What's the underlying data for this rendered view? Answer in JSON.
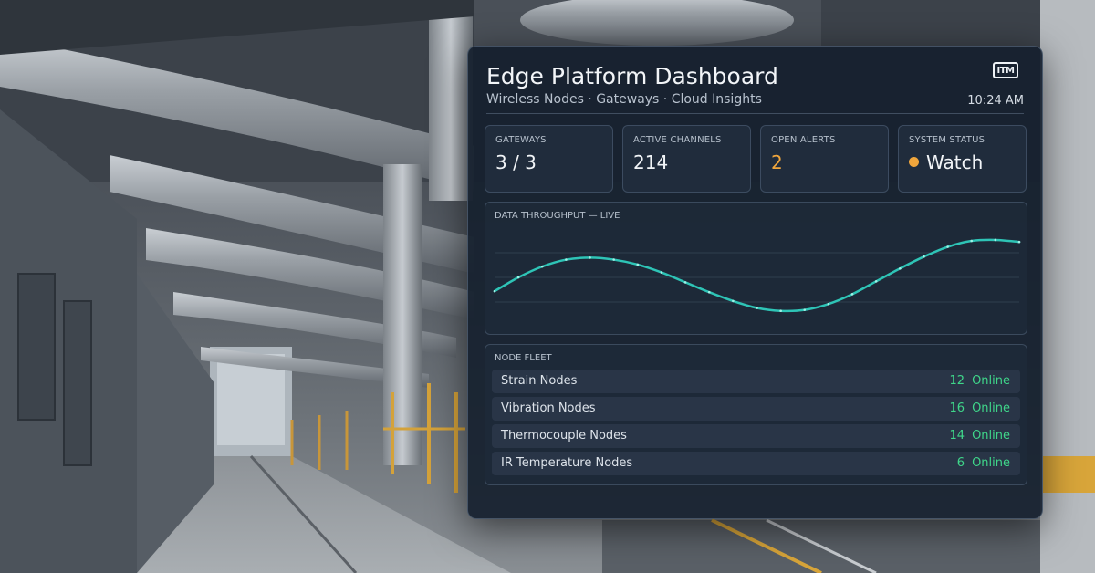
{
  "header": {
    "title": "Edge Platform Dashboard",
    "subtitle": "Wireless Nodes · Gateways · Cloud Insights",
    "logo": "ITM",
    "time": "10:24 AM"
  },
  "stats": [
    {
      "label": "GATEWAYS",
      "value": "3 / 3"
    },
    {
      "label": "ACTIVE CHANNELS",
      "value": "214"
    },
    {
      "label": "OPEN ALERTS",
      "value": "2"
    },
    {
      "label": "SYSTEM STATUS",
      "value": "Watch"
    }
  ],
  "colors": {
    "accent_line": "#2ec4b6",
    "alert": "#f0a63c",
    "online": "#3fd68a"
  },
  "throughput": {
    "label": "DATA THROUGHPUT — LIVE"
  },
  "chart_data": {
    "type": "line",
    "title": "",
    "xlabel": "",
    "ylabel": "",
    "x": [
      0,
      1,
      2,
      3,
      4,
      5,
      6,
      7,
      8,
      9,
      10,
      11,
      12,
      13,
      14,
      15,
      16,
      17,
      18,
      19,
      20,
      21,
      22
    ],
    "series": [
      {
        "values": [
          0.36,
          0.5,
          0.61,
          0.68,
          0.7,
          0.68,
          0.63,
          0.55,
          0.45,
          0.35,
          0.26,
          0.19,
          0.16,
          0.17,
          0.23,
          0.33,
          0.46,
          0.59,
          0.71,
          0.81,
          0.87,
          0.88,
          0.86
        ]
      }
    ],
    "ylim": [
      0,
      1
    ],
    "grid": true,
    "legend": "none"
  },
  "fleet": {
    "label": "NODE FLEET",
    "status_text": "Online",
    "rows": [
      {
        "name": "Strain Nodes",
        "count": "12"
      },
      {
        "name": "Vibration Nodes",
        "count": "16"
      },
      {
        "name": "Thermocouple Nodes",
        "count": "14"
      },
      {
        "name": "IR Temperature Nodes",
        "count": "6"
      }
    ]
  }
}
